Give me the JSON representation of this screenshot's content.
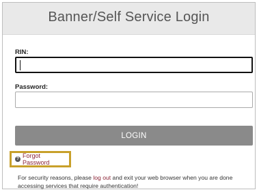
{
  "header": {
    "title": "Banner/Self Service Login"
  },
  "form": {
    "rin_label": "RIN:",
    "rin_value": "",
    "password_label": "Password:",
    "password_value": "",
    "login_label": "LOGIN"
  },
  "forgot": {
    "icon": "question-circle-icon",
    "label": "Forgot Password"
  },
  "notice": {
    "before": "For security reasons, please ",
    "link": "log out",
    "after": " and exit your web browser when you are done accessing services that require authentication!"
  },
  "colors": {
    "header_bg": "#e9e9e9",
    "button_bg": "#8a8a8a",
    "link": "#8b2335",
    "highlight_border": "#c8a02a"
  }
}
